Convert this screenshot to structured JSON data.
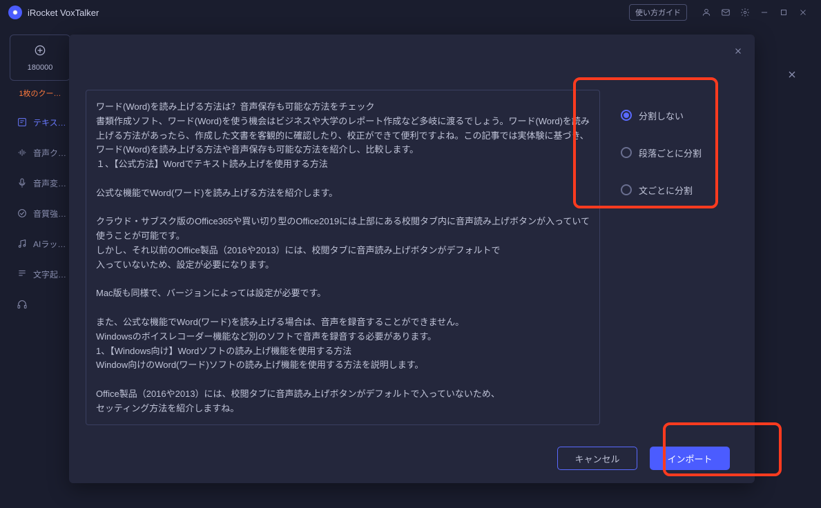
{
  "titlebar": {
    "app_name": "iRocket VoxTalker",
    "guide_button": "使い方ガイド"
  },
  "sidebar": {
    "credit_count": "180000",
    "credit_tab": "1枚のクー…",
    "items": [
      {
        "label": "テキス…"
      },
      {
        "label": "音声ク…"
      },
      {
        "label": "音声変…"
      },
      {
        "label": "音質強…"
      },
      {
        "label": "AIラッ…"
      },
      {
        "label": "文字起…"
      }
    ]
  },
  "modal": {
    "text_content": "ワード(Word)を読み上げる方法は？音声保存も可能な方法をチェック\n書類作成ソフト、ワード(Word)を使う機会はビジネスや大学のレポート作成など多岐に渡るでしょう。ワード(Word)を読み上げる方法があったら、作成した文書を客観的に確認したり、校正ができて便利ですよね。この記事では実体験に基づき、ワード(Word)を読み上げる方法や音声保存も可能な方法を紹介し、比較します。\n１、【公式方法】Wordでテキスト読み上げを使用する方法\n\n公式な機能でWord(ワード)を読み上げる方法を紹介します。\n\nクラウド・サブスク版のOffice365や買い切り型のOffice2019には上部にある校閲タブ内に音声読み上げボタンが入っていて使うことが可能です。\nしかし、それ以前のOffice製品（2016や2013）には、校閲タブに音声読み上げボタンがデフォルトで\n入っていないため、設定が必要になります。\n\nMac版も同様で、バージョンによっては設定が必要です。\n\nまた、公式な機能でWord(ワード)を読み上げる場合は、音声を録音することができません。\nWindowsのボイスレコーダー機能など別のソフトで音声を録音する必要があります。\n1、【Windows向け】Wordソフトの読み上げ機能を使用する方法\nWindow向けのWord(ワード)ソフトの読み上げ機能を使用する方法を説明します。\n\nOffice製品（2016や2013）には、校閲タブに音声読み上げボタンがデフォルトで入っていないため、\nセッティング方法を紹介しますね。",
    "radios": [
      {
        "label": "分割しない",
        "selected": true
      },
      {
        "label": "段落ごとに分割",
        "selected": false
      },
      {
        "label": "文ごとに分割",
        "selected": false
      }
    ],
    "cancel_button": "キャンセル",
    "import_button": "インポート"
  }
}
